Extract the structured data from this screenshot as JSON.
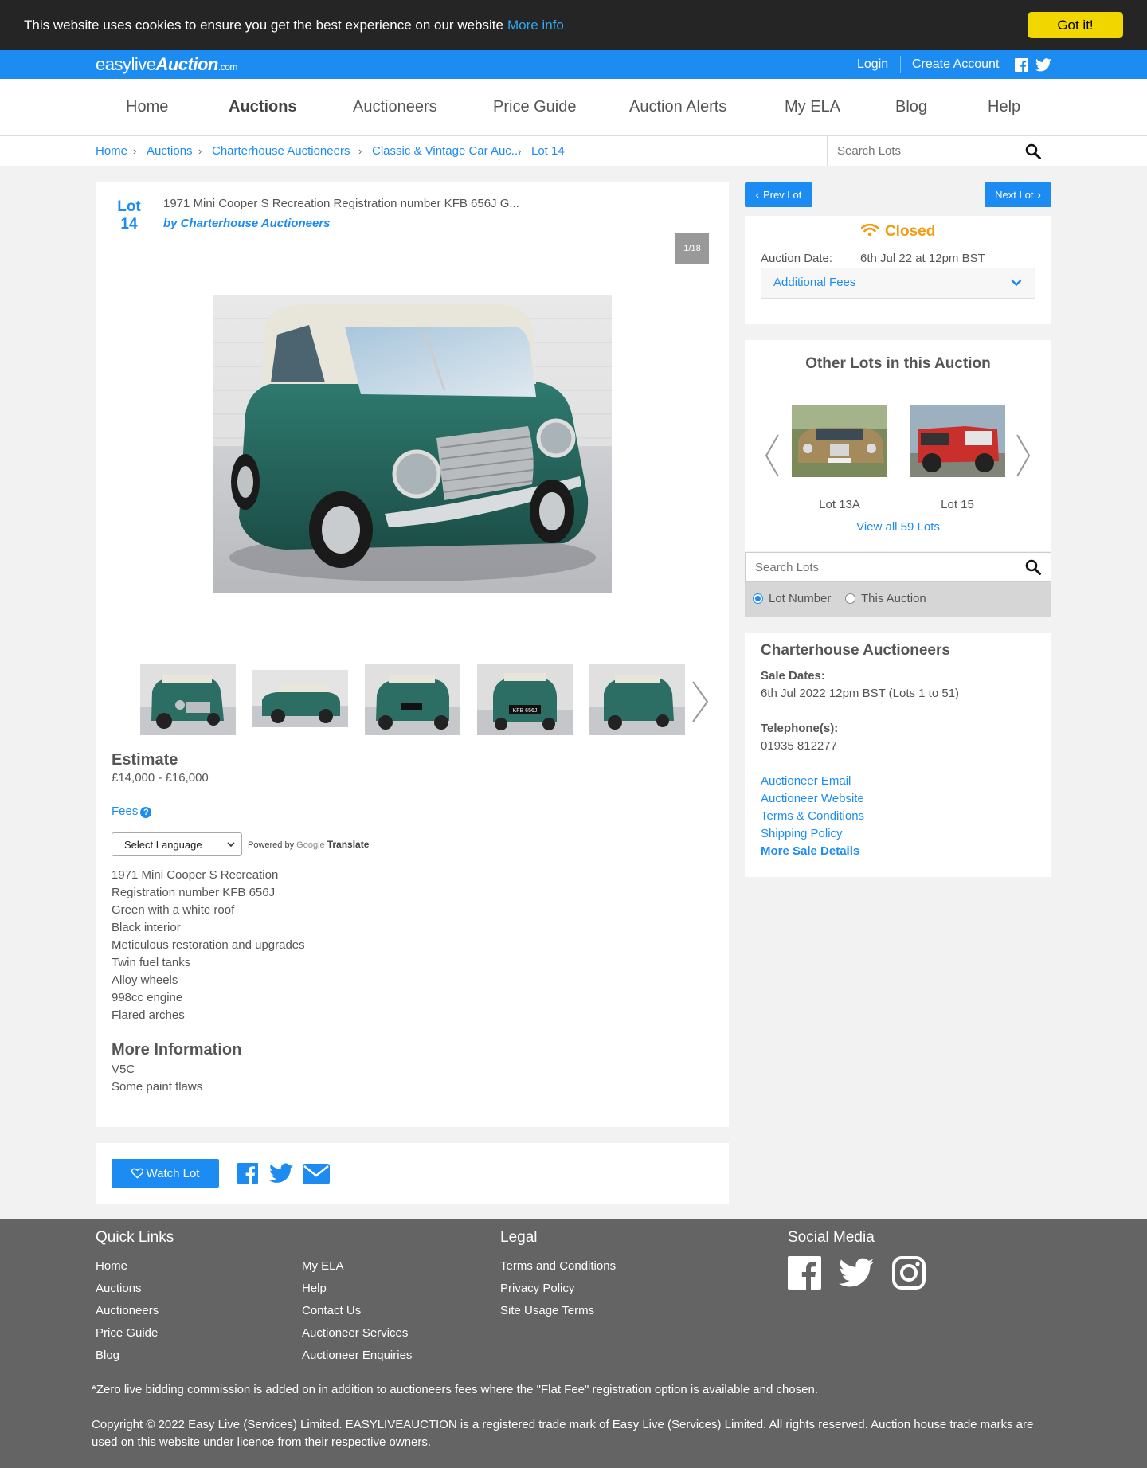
{
  "cookie": {
    "text": "This website uses cookies to ensure you get the best experience on our website",
    "more": "More info",
    "button": "Got it!"
  },
  "topbar": {
    "logo_main": "easylive",
    "logo_bold": "Auction",
    "logo_com": ".com",
    "login": "Login",
    "create": "Create Account"
  },
  "nav": {
    "items": [
      "Home",
      "Auctions",
      "Auctioneers",
      "Price Guide",
      "Auction Alerts",
      "My ELA",
      "Blog",
      "Help"
    ],
    "active": "Auctions"
  },
  "breadcrumb": {
    "items": [
      "Home",
      "Auctions",
      "Charterhouse Auctioneers",
      "Classic & Vintage Car Auc...",
      "Lot 14"
    ],
    "search_placeholder": "Search Lots"
  },
  "lot": {
    "label_line1": "Lot",
    "label_line2": "14",
    "title": "1971 Mini Cooper S Recreation Registration number KFB 656J G...",
    "by": "by Charterhouse Auctioneers",
    "image_count": "1/18",
    "estimate_heading": "Estimate",
    "estimate_value": "£14,000 - £16,000",
    "fees": "Fees",
    "language": "Select Language",
    "powered_by": "Powered by",
    "google": "Google",
    "translate": "Translate",
    "description": [
      "1971 Mini Cooper S Recreation",
      "Registration number KFB 656J",
      "Green with a white roof",
      "Black interior",
      "Meticulous restoration and upgrades",
      "Twin fuel tanks",
      "Alloy wheels",
      "998cc engine",
      "Flared arches"
    ],
    "more_heading": "More Information",
    "more": [
      "V5C",
      "Some paint flaws"
    ],
    "thumb_plate": "KFB 656J",
    "watch": "Watch Lot"
  },
  "right": {
    "prev": "Prev Lot",
    "next": "Next Lot",
    "status": "Closed",
    "status_color": "#f39c12",
    "auction_date_label": "Auction Date:",
    "auction_date_value": "6th Jul 22 at 12pm BST",
    "additional_fees": "Additional Fees",
    "other_heading": "Other Lots in this Auction",
    "other_lots": [
      "Lot 13A",
      "Lot 15"
    ],
    "view_all": "View all 59 Lots",
    "search_placeholder": "Search Lots",
    "radio_lot": "Lot Number",
    "radio_auction": "This Auction",
    "auctioneer": "Charterhouse Auctioneers",
    "sale_dates_label": "Sale Dates:",
    "sale_dates_value": "6th Jul 2022 12pm BST (Lots 1 to 51)",
    "telephone_label": "Telephone(s):",
    "telephone_value": "01935 812277",
    "links": [
      "Auctioneer Email",
      "Auctioneer Website",
      "Terms & Conditions",
      "Shipping Policy"
    ],
    "more_details": "More Sale Details"
  },
  "footer": {
    "quick_heading": "Quick Links",
    "quick_col1": [
      "Home",
      "Auctions",
      "Auctioneers",
      "Price Guide",
      "Blog"
    ],
    "quick_col2": [
      "My ELA",
      "Help",
      "Contact Us",
      "Auctioneer Services",
      "Auctioneer Enquiries"
    ],
    "legal_heading": "Legal",
    "legal": [
      "Terms and Conditions",
      "Privacy Policy",
      "Site Usage Terms"
    ],
    "social_heading": "Social Media",
    "note": "*Zero live bidding commission is added on in addition to auctioneers fees where the \"Flat Fee\" registration option is available and chosen.",
    "copyright": "Copyright © 2022 Easy Live (Services) Limited. EASYLIVEAUCTION is a registered trade mark of Easy Live (Services) Limited. All rights reserved. Auction house trade marks are used on this website under licence from their respective owners."
  },
  "colors": {
    "brand_blue": "#1d8cf2",
    "cookie_button": "#f1d600",
    "footer_bg": "#646464"
  }
}
